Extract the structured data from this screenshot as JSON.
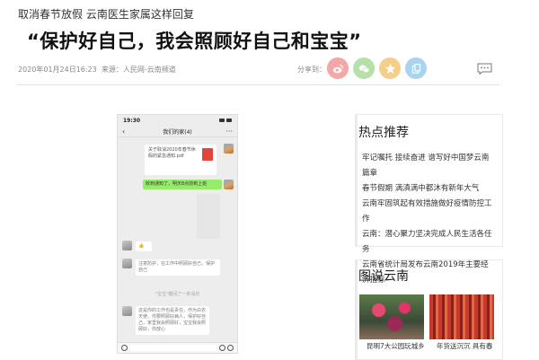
{
  "article": {
    "subtitle": "取消春节放假 云南医生家属这样回复",
    "headline": "“保护好自己，我会照顾好自己和宝宝”",
    "date": "2020年01月24日16:23",
    "source": "来源：人民网-云南频道",
    "share_label": "分享到：",
    "share_buttons": [
      {
        "icon": "weibo-icon",
        "color": "#f4a7a6"
      },
      {
        "icon": "wechat-icon",
        "color": "#b7e0a8"
      },
      {
        "icon": "qzone-star-icon",
        "color": "#f5cf8a"
      },
      {
        "icon": "copy-link-icon",
        "color": "#a9d3f0"
      }
    ],
    "comment_icon": "comment-icon"
  },
  "phone": {
    "time": "19:30",
    "chat_title": "我们的家(4)",
    "file_name": "关于取消2020年春节休假的紧急通知.pdf",
    "green_msg": "收到通知了，明天8点前到上班",
    "msg1": "👍",
    "msg2": "注意防护，在工作中照顾好自己，保护自己",
    "note": "\"宝宝\"撤回了一条消息",
    "msg3": "这是你的工作也是责任，作为白衣天使，你要照顾好病人，保护好自己，家里我会照顾好，宝宝我会照顾好，你放心"
  },
  "sidebar": {
    "hot_title": "热点推荐",
    "hot_items": [
      "牢记嘱托 接续奋进 谱写好中国梦云南篇章",
      "春节假期 满滇满中都沐有新年大气",
      "云南牢固筑起有效措施做好疫情防控工作",
      "云南：潜心聚力坚决完成人民生活各任务",
      "云南省统计局发布云南2019年主要经济指标"
    ],
    "photo_title": "图说云南",
    "photos": [
      {
        "caption": "昆明7大公园玩城乡"
      },
      {
        "caption": "年货送沉沉 具有春"
      }
    ]
  }
}
